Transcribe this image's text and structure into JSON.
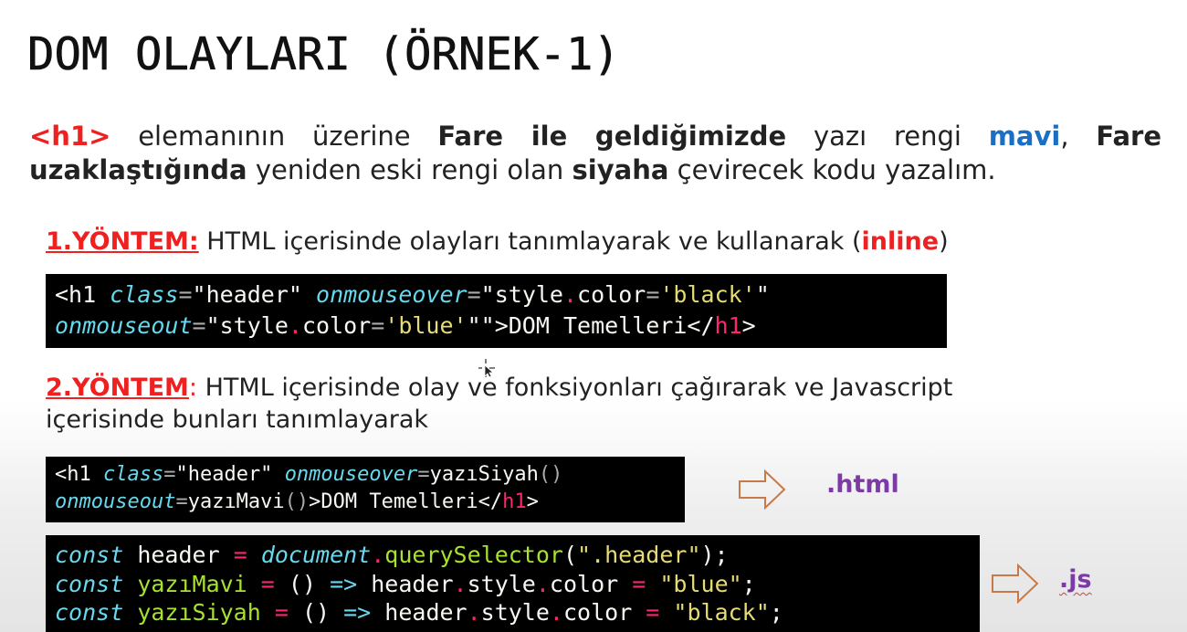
{
  "slide": {
    "title": "DOM OLAYLARI (ÖRNEK-1)",
    "intro": {
      "tag": "<h1>",
      "t1": " elemanının üzerine ",
      "b1": "Fare ile geldiğimizde",
      "t2": " yazı rengi ",
      "blue_word": "mavi",
      "t3": ", ",
      "b2": "Fare uzaklaştığında",
      "t4": " yeniden eski rengi olan ",
      "b3": "siyaha",
      "t5": " çevirecek kodu yazalım."
    },
    "method1": {
      "label": "1.YÖNTEM:",
      "text": " HTML içerisinde olayları tanımlayarak ve kullanarak (",
      "inline": "inline",
      "close": ")"
    },
    "method2": {
      "label": "2.YÖNTEM",
      "colon": ":",
      "text": " HTML içerisinde olay ve fonksiyonları çağırarak ve Javascript içerisinde  bunları tanımlayarak"
    },
    "ext_html": ".html",
    "ext_js": ".js"
  },
  "icons": [
    "arrow-right-outline-icon",
    "mouse-cursor-icon"
  ],
  "colors": {
    "red": "#ee2020",
    "blue": "#1a6fc4",
    "purple": "#7b3aa6",
    "arrow": "#c8794a"
  },
  "code1": {
    "c01": "<h1 ",
    "c02": "class",
    "c03": "=",
    "c04": "\"header\"",
    "c05": " ",
    "c06": "onmouseover",
    "c07": "=",
    "c08": "\"style",
    "c09": ".",
    "c10": "color",
    "c11": "=",
    "c12": "'black'",
    "c13": "\"",
    "c14": "onmouseout",
    "c15": "=",
    "c16": "\"style",
    "c17": ".",
    "c18": "color",
    "c19": "=",
    "c20": "'blue'",
    "c21": "\"",
    "c22": "\">DOM Temelleri</",
    "c23": "h1",
    "c24": ">"
  },
  "code2": {
    "c01": "<h1 ",
    "c02": "class",
    "c03": "=",
    "c04": "\"header\"",
    "c05": " ",
    "c06": "onmouseover",
    "c07": "=",
    "c08": "yazıSiyah",
    "c09": "()",
    "c10": "onmouseout",
    "c11": "=",
    "c12": "yazıMavi",
    "c13": "()",
    "c14": ">DOM Temelleri</",
    "c15": "h1",
    "c16": ">"
  },
  "code3": {
    "c01": "const",
    "c02": " header ",
    "c03": "=",
    "c04": " ",
    "c05": "document",
    "c06": ".",
    "c07": "querySelector",
    "c08": "(",
    "c09": "\".header\"",
    "c10": ");",
    "c11": "const",
    "c12": " yazıMavi ",
    "c13": "=",
    "c14": " () ",
    "c15": "=>",
    "c16": " header",
    "c17": ".",
    "c18": "style",
    "c19": ".",
    "c20": "color ",
    "c21": "=",
    "c22": " ",
    "c23": "\"blue\"",
    "c24": ";",
    "c25": "const",
    "c26": " yazıSiyah ",
    "c27": "=",
    "c28": " () ",
    "c29": "=>",
    "c30": " header",
    "c31": ".",
    "c32": "style",
    "c33": ".",
    "c34": "color ",
    "c35": "=",
    "c36": " ",
    "c37": "\"black\"",
    "c38": ";"
  }
}
